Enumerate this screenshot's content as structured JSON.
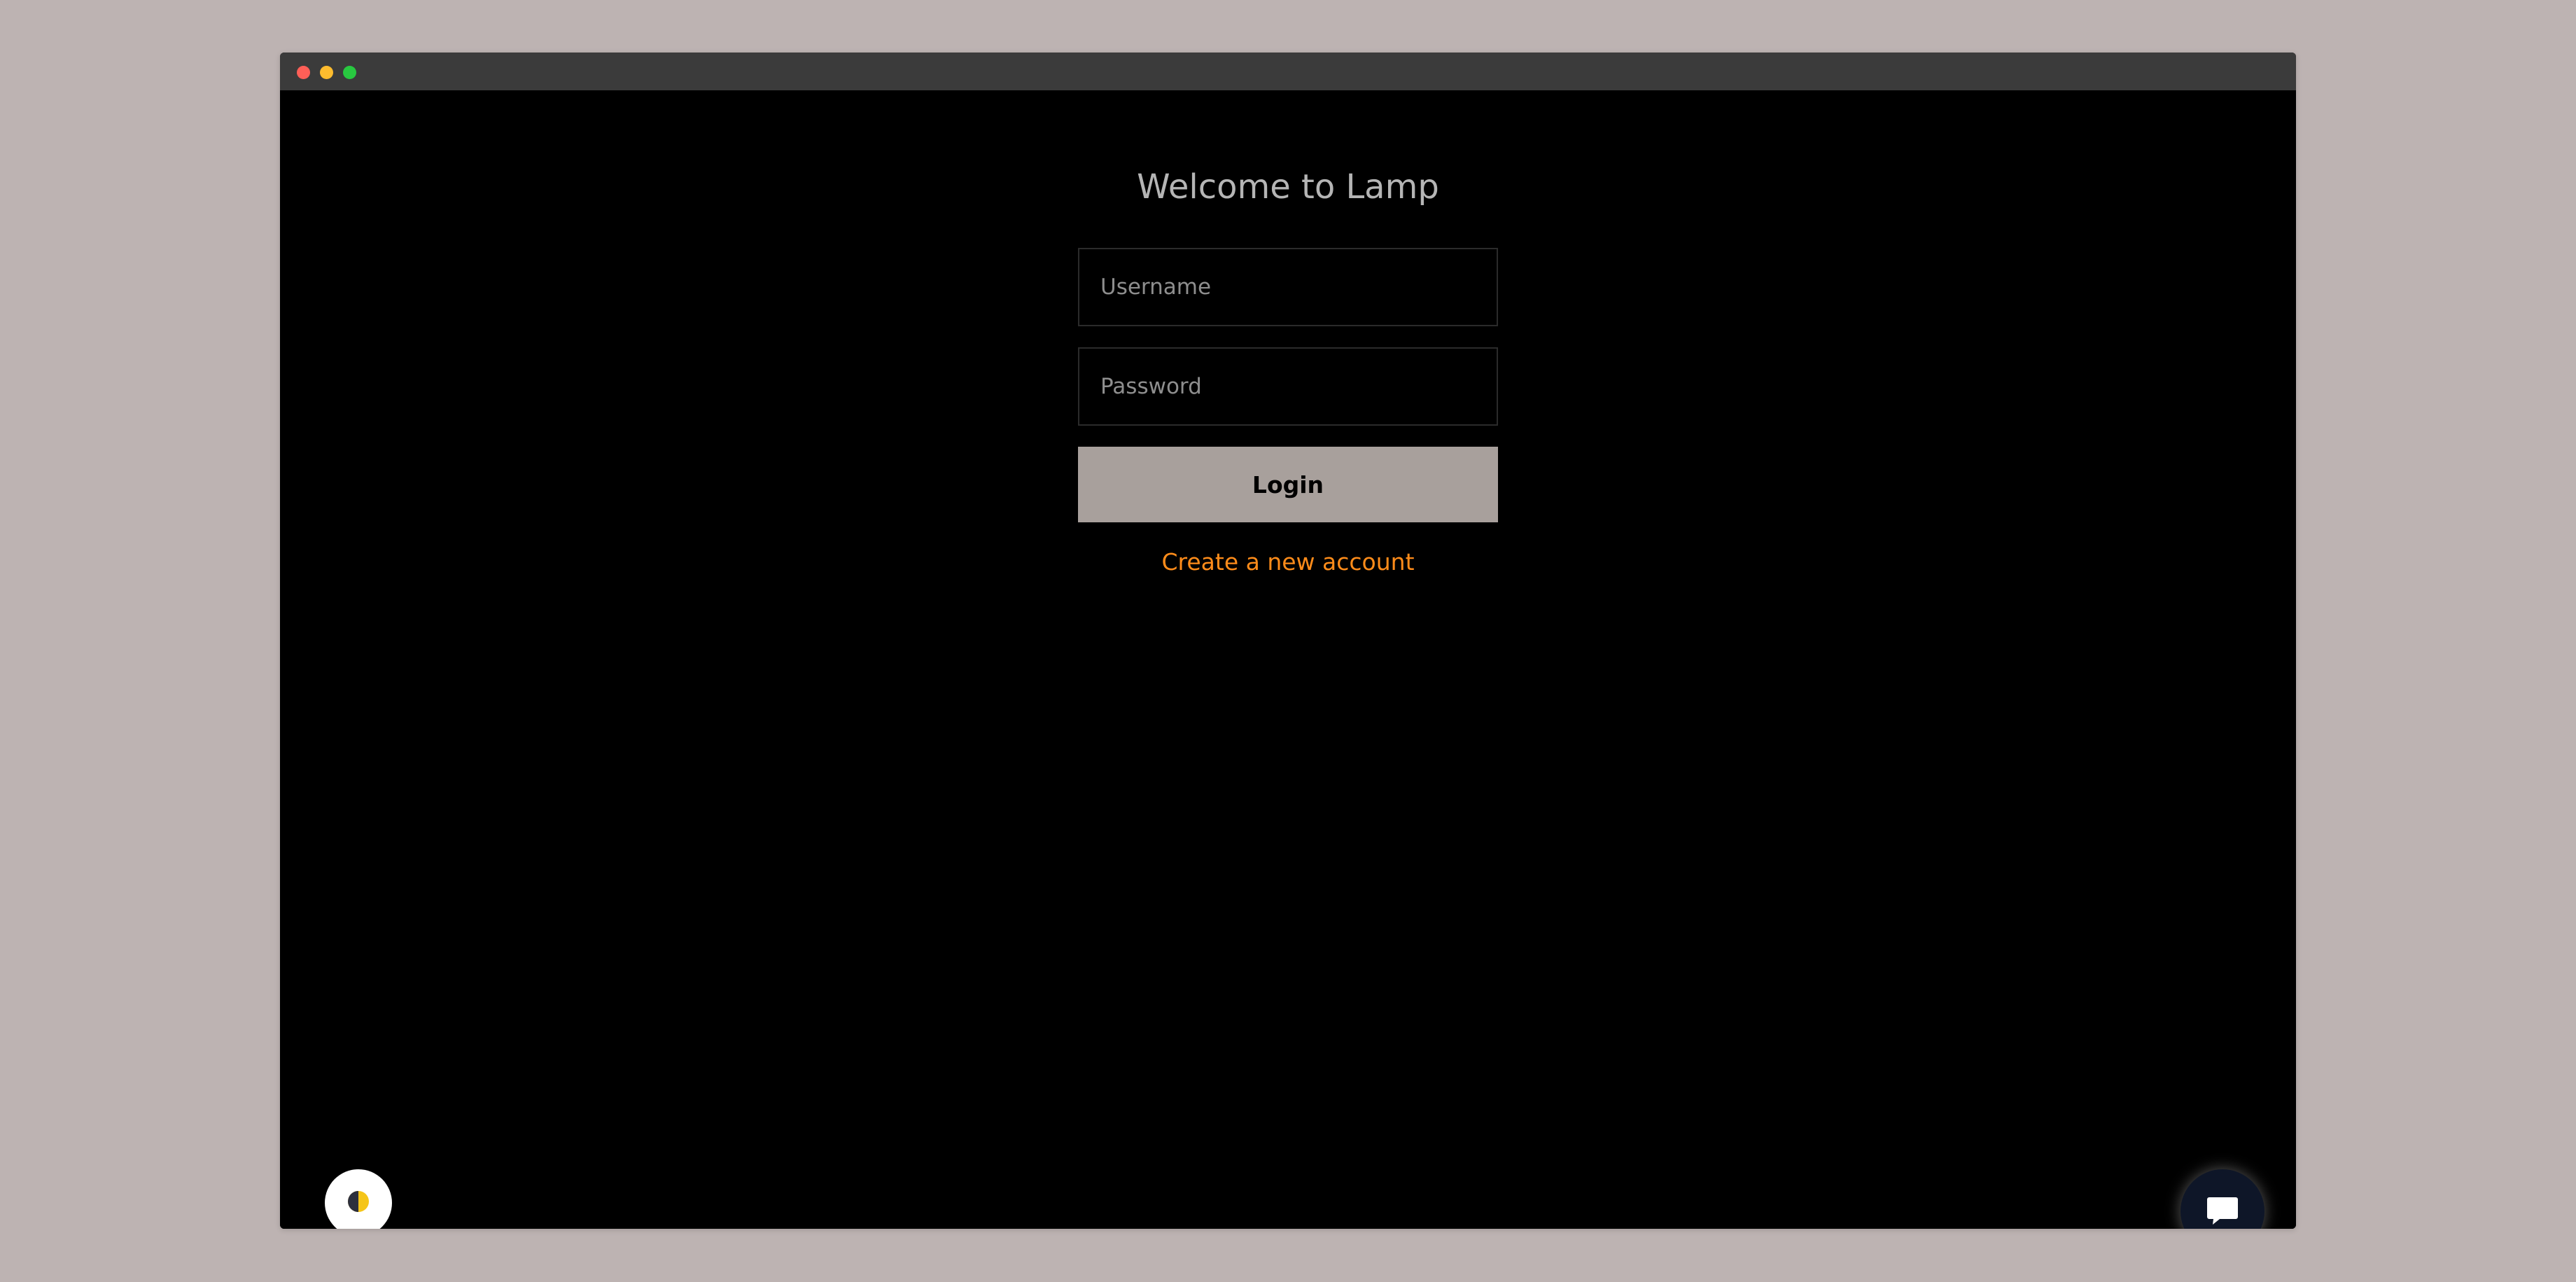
{
  "page": {
    "title": "Welcome to Lamp"
  },
  "form": {
    "username_placeholder": "Username",
    "password_placeholder": "Password",
    "login_label": "Login",
    "create_account_label": "Create a new account"
  },
  "icons": {
    "theme_toggle": "half-moon-contrast-icon",
    "chat": "chat-bubble-icon"
  },
  "colors": {
    "background": "#000000",
    "login_button": "#a8a09c",
    "link": "#ff8c1a",
    "chat_button": "#0e1628",
    "theme_icon_accent": "#f5c518"
  }
}
